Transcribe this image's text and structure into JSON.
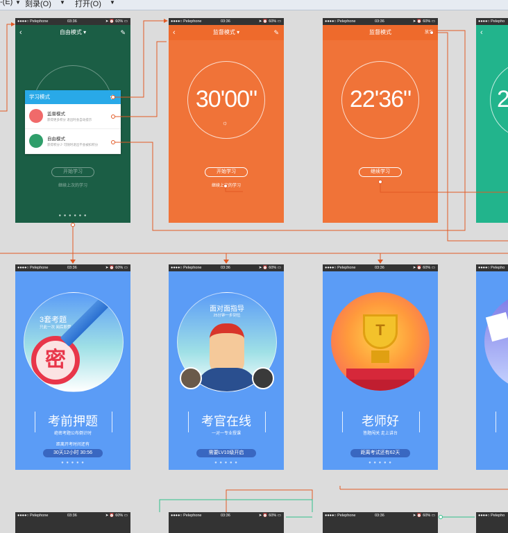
{
  "menubar": {
    "items": [
      "-(E)",
      "刻录(O)",
      "打开(O)"
    ]
  },
  "statusbar": {
    "carrier": "●●●●○ Pelephone",
    "time": "03:36",
    "right": "➤ ⏰ 60% ▭"
  },
  "screens": {
    "free_mode": {
      "title": "自由模式 ▾",
      "start": "开始学习",
      "continue": "继续上次的学习",
      "popup": {
        "title": "学习模式",
        "items": [
          {
            "title": "监督模式",
            "desc": "获得更多积分 退出时会自动提示"
          },
          {
            "title": "自由模式",
            "desc": "获得积分少 可随时退出不会被扣积分"
          }
        ]
      }
    },
    "supervise_mode": {
      "title": "监督模式 ▾",
      "time": "30'00\"",
      "start": "开始学习",
      "continue": "继续上次的学习"
    },
    "supervise_running": {
      "title": "监督模式",
      "quit": "放弃",
      "time": "22'36\"",
      "continue": "继续学习"
    },
    "card1": {
      "circle_title": "3套考题",
      "circle_sub": "只此一次 阅后即焚",
      "stamp": "密",
      "title": "考前押题",
      "sub": "绝密考题公布倒计时",
      "note": "距离开考时间还有",
      "countdown": "30天12小时 30:56"
    },
    "card2": {
      "circle_title": "面对面指导",
      "circle_sub": "25分钟一步到位",
      "title": "考官在线",
      "sub": "一对一专业授课",
      "unlock": "需要LV10级开启"
    },
    "card3": {
      "title": "老师好",
      "sub": "答题闯关 走上讲台",
      "countdown": "距离考试还有62天"
    }
  },
  "colors": {
    "green": "#1b5e45",
    "orange": "#f07338",
    "teal": "#22b48c",
    "blue": "#5b9cf6",
    "wire_orange": "#e25a25",
    "wire_green": "#2fbf8a"
  }
}
